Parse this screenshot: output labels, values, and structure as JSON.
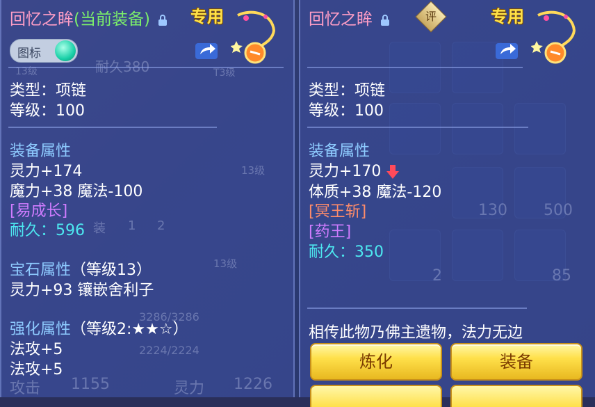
{
  "left": {
    "name": "回忆之眸",
    "current_tag": "(当前装备)",
    "exclusive": "专用",
    "toggle_label": "图标",
    "type_line": "类型：项链",
    "level_line": "等级：100",
    "equip_attr_title": "装备属性",
    "attrs": [
      "灵力+174",
      "魔力+38 魔法-100"
    ],
    "special": "[易成长]",
    "durability": "耐久：596",
    "gem_title": "宝石属性",
    "gem_level": "（等级13）",
    "gem_line": "灵力+93 镶嵌舍利子",
    "enhance_title": "强化属性",
    "enhance_level": "（等级2:★★☆）",
    "enhance_lines": [
      "法攻+5",
      "法攻+5"
    ]
  },
  "right": {
    "name": "回忆之眸",
    "rate_badge": "评",
    "exclusive": "专用",
    "type_line": "类型：项链",
    "level_line": "等级：100",
    "equip_attr_title": "装备属性",
    "attr1": "灵力+170",
    "attr2": "体质+38 魔法-120",
    "special1": "[冥王斩]",
    "special2": "[药王]",
    "durability": "耐久：350",
    "description": "相传此物乃佛主遗物，法力无边",
    "buttons": {
      "refine": "炼化",
      "equip": "装备"
    }
  },
  "background": {
    "durability_faint": "耐久380",
    "tier_labels": [
      "13级",
      "T3级",
      "13级",
      "13级"
    ],
    "slot_nums": [
      "1",
      "2"
    ],
    "slot_label": "装",
    "hp_bar": "3286/3286",
    "mp_bar": "2224/2224",
    "attack_label": "攻击",
    "attack_value": "1155",
    "spirit_label": "灵力",
    "spirit_value": "1226",
    "item_counts": [
      "130",
      "500",
      "2",
      "85"
    ]
  },
  "colors": {
    "name_pink": "#ff9ec6",
    "current_green": "#7cf06a",
    "section_blue": "#8ecbff",
    "button_gold": "#ffe04a"
  }
}
